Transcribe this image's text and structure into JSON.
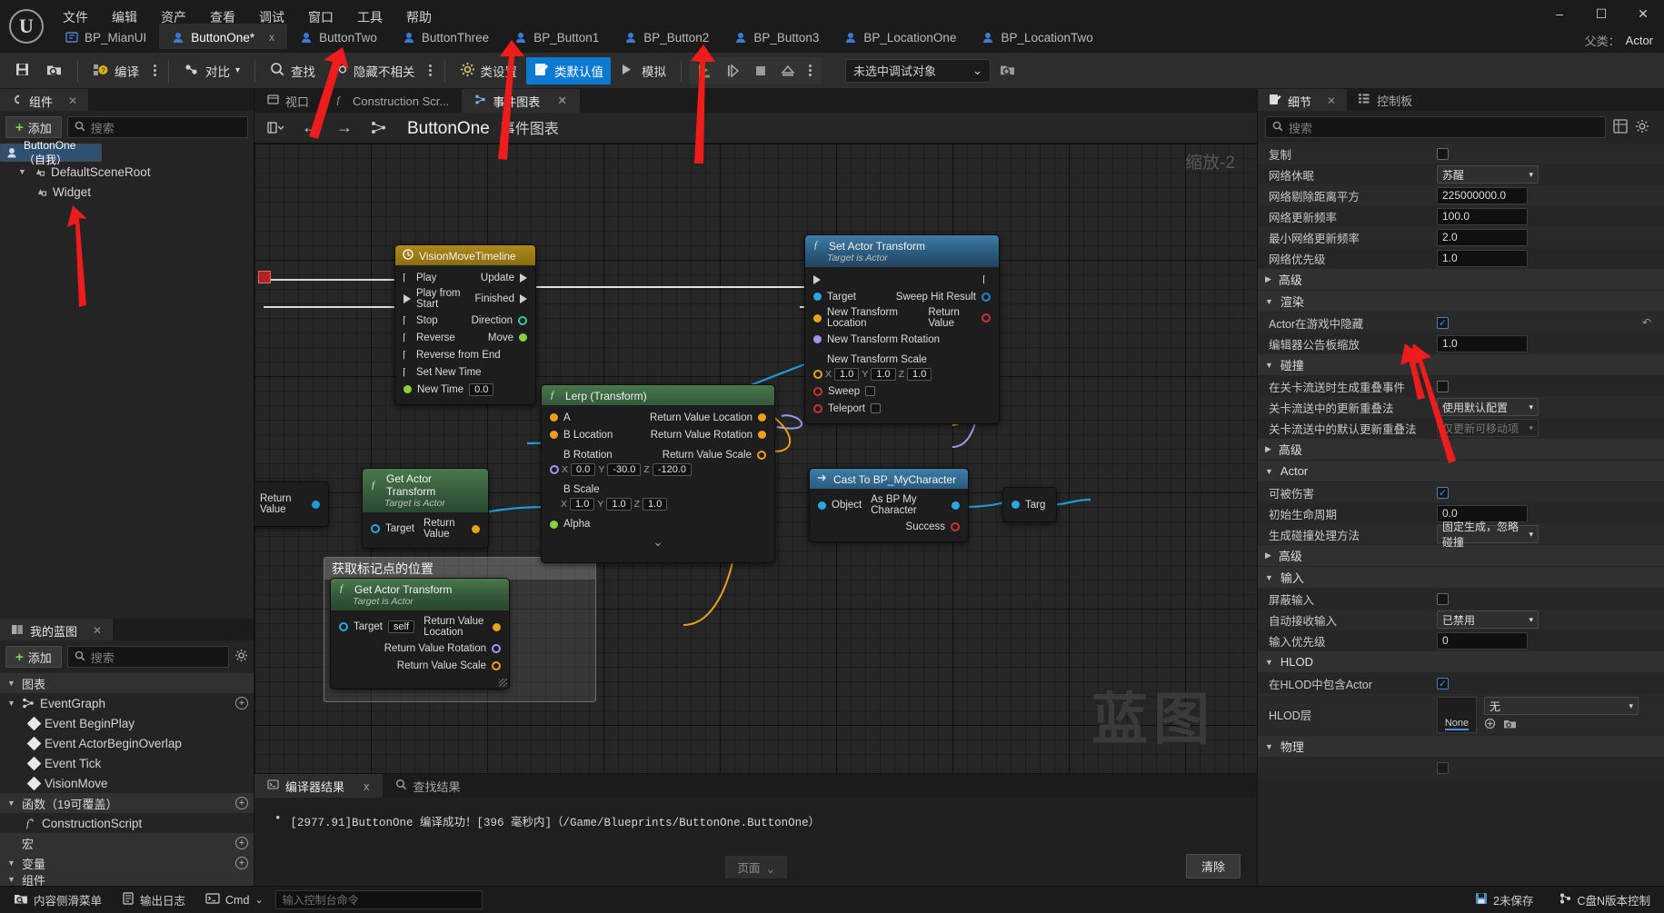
{
  "app": {
    "menus": [
      "文件",
      "编辑",
      "资产",
      "查看",
      "调试",
      "窗口",
      "工具",
      "帮助"
    ],
    "window_buttons": {
      "minimize": "–",
      "maximize": "☐",
      "close": "✕"
    }
  },
  "tabs": {
    "items": [
      {
        "label": "BP_MianUI",
        "icon": "blueprint-ui-icon",
        "active": false,
        "closable": false
      },
      {
        "label": "ButtonOne*",
        "icon": "blueprint-actor-icon",
        "active": true,
        "closable": true,
        "close": "x"
      },
      {
        "label": "ButtonTwo",
        "icon": "blueprint-actor-icon",
        "active": false,
        "closable": false
      },
      {
        "label": "ButtonThree",
        "icon": "blueprint-actor-icon",
        "active": false,
        "closable": false
      },
      {
        "label": "BP_Button1",
        "icon": "blueprint-actor-icon",
        "active": false,
        "closable": false
      },
      {
        "label": "BP_Button2",
        "icon": "blueprint-actor-icon",
        "active": false,
        "closable": false
      },
      {
        "label": "BP_Button3",
        "icon": "blueprint-actor-icon",
        "active": false,
        "closable": false
      },
      {
        "label": "BP_LocationOne",
        "icon": "blueprint-actor-icon",
        "active": false,
        "closable": false
      },
      {
        "label": "BP_LocationTwo",
        "icon": "blueprint-actor-icon",
        "active": false,
        "closable": false
      }
    ],
    "parent_label": "父类：",
    "parent_value": "Actor"
  },
  "toolbar": {
    "save_icon": "save-icon",
    "browse_icon": "browse-content-icon",
    "compile_label": "编译",
    "diff_label": "对比",
    "find_label": "查找",
    "hide_unrelated_label": "隐藏不相关",
    "class_settings_label": "类设置",
    "class_defaults_label": "类默认值",
    "simulate_label": "模拟",
    "debug_object": "未选中调试对象",
    "debug_object_caret": "⌄"
  },
  "components_panel": {
    "tab_title": "组件",
    "close": "✕",
    "add_label": "添加",
    "search_placeholder": "搜索",
    "items": [
      {
        "label": "ButtonOne（自我）",
        "depth": 0,
        "selected": true,
        "icon": "actor-icon",
        "caret": ""
      },
      {
        "label": "DefaultSceneRoot",
        "depth": 1,
        "selected": false,
        "icon": "scene-component-icon",
        "caret": "▼"
      },
      {
        "label": "Widget",
        "depth": 2,
        "selected": false,
        "icon": "scene-component-icon",
        "caret": ""
      }
    ]
  },
  "myblueprint_panel": {
    "tab_title": "我的蓝图",
    "close": "✕",
    "add_label": "添加",
    "search_placeholder": "搜索",
    "sections": [
      {
        "label": "图表",
        "caret": "▼",
        "add": false,
        "items": []
      },
      {
        "label": "EventGraph",
        "caret": "▼",
        "is_graph": true,
        "add": true,
        "items": [
          {
            "label": "Event BeginPlay"
          },
          {
            "label": "Event ActorBeginOverlap"
          },
          {
            "label": "Event Tick"
          },
          {
            "label": "VisionMove"
          }
        ]
      },
      {
        "label": "函数（19可覆盖）",
        "caret": "▼",
        "add": true,
        "items": [
          {
            "label": "ConstructionScript",
            "icon": "function-icon"
          }
        ]
      },
      {
        "label": "宏",
        "caret": "",
        "add": true,
        "items": []
      },
      {
        "label": "变量",
        "caret": "▼",
        "add": true,
        "items": []
      },
      {
        "label": "组件",
        "caret": "▼",
        "add": false,
        "items": []
      }
    ]
  },
  "graph_panel": {
    "tabs": [
      {
        "label": "视口",
        "icon": "viewport-icon",
        "active": false,
        "closable": false
      },
      {
        "label": "Construction Scr...",
        "icon": "function-icon",
        "active": false,
        "closable": false
      },
      {
        "label": "事件图表",
        "icon": "eventgraph-icon",
        "active": true,
        "closable": true,
        "close": "✕"
      }
    ],
    "nav_back": "←",
    "nav_forward": "→",
    "breadcrumb_main": "ButtonOne",
    "breadcrumb_sub": "事件图表",
    "zoom_label": "缩放-2",
    "watermark": "蓝图"
  },
  "nodes": {
    "timeline": {
      "title": "VisionMoveTimeline",
      "icon": "clock-icon",
      "inputs": [
        "Play",
        "Play from Start",
        "Stop",
        "Reverse",
        "Reverse from End",
        "Set New Time"
      ],
      "new_time_label": "New Time",
      "new_time_value": "0.0",
      "outputs": [
        {
          "label": "Update",
          "type": "exec"
        },
        {
          "label": "Finished",
          "type": "exec"
        },
        {
          "label": "Direction",
          "type": "byte"
        },
        {
          "label": "Move",
          "type": "float"
        }
      ]
    },
    "set_actor_transform": {
      "title": "Set Actor Transform",
      "subtitle": "Target is Actor",
      "inputs": [
        {
          "label": "Target",
          "color": "#28a8e0"
        },
        {
          "label": "New Transform Location",
          "color": "#e8a11a"
        },
        {
          "label": "New Transform Rotation",
          "color": "#9a9ae8"
        }
      ],
      "scale_label": "New Transform Scale",
      "scale": {
        "x": "1.0",
        "y": "1.0",
        "z": "1.0"
      },
      "sweep_label": "Sweep",
      "teleport_label": "Teleport",
      "outputs": [
        {
          "label": "Sweep Hit Result",
          "color": "#2f7fd0"
        },
        {
          "label": "Return Value",
          "color": "#c53434"
        }
      ]
    },
    "lerp_transform": {
      "title": "Lerp (Transform)",
      "icon": "function-icon",
      "inputs": [
        {
          "label": "A",
          "color": "#e8a11a"
        },
        {
          "label": "B Location",
          "color": "#e8a11a"
        },
        {
          "label": "B Rotation",
          "color": "#9a9ae8",
          "x": "0.0",
          "y": "-30.0",
          "z": "-120.0"
        },
        {
          "label": "B Scale",
          "color": "#e8a11a",
          "x": "1.0",
          "y": "1.0",
          "z": "1.0"
        },
        {
          "label": "Alpha",
          "color": "#8ccf3f"
        }
      ],
      "outputs": [
        {
          "label": "Return Value Location",
          "color": "#e8a11a"
        },
        {
          "label": "Return Value Rotation",
          "color": "#e8a11a"
        },
        {
          "label": "Return Value Scale",
          "color": "#e8a11a"
        }
      ],
      "collapse": "⌄"
    },
    "get_actor_transform_1": {
      "title": "Get Actor Transform",
      "subtitle": "Target is Actor",
      "target_label": "Target",
      "return_label": "Return Value"
    },
    "cast_node": {
      "title": "Cast To BP_MyCharacter",
      "object_label": "Object",
      "as_label": "As BP My Character",
      "success_label": "Success"
    },
    "right_node": {
      "target_label": "Targ"
    },
    "comment": {
      "title": "获取标记点的位置",
      "node_title": "Get Actor Transform",
      "node_subtitle": "Target is Actor",
      "target_label": "Target",
      "target_value": "self",
      "outputs": [
        "Return Value Location",
        "Return Value Rotation",
        "Return Value Scale"
      ]
    }
  },
  "results_panel": {
    "tabs": [
      {
        "label": "编译器结果",
        "icon": "compiler-icon",
        "active": true,
        "close": "x"
      },
      {
        "label": "查找结果",
        "icon": "search-icon",
        "active": false
      }
    ],
    "message": "[2977.91]ButtonOne 编译成功！[396 毫秒内]（/Game/Blueprints/ButtonOne.ButtonOne）",
    "page_label": "页面 ⌄",
    "clear_label": "清除"
  },
  "details_panel": {
    "tabs": [
      {
        "label": "细节",
        "icon": "details-icon",
        "active": true,
        "close": "✕"
      },
      {
        "label": "控制板",
        "icon": "palette-icon",
        "active": false
      }
    ],
    "search_placeholder": "搜索",
    "groups": [
      {
        "type": "props",
        "rows": [
          {
            "name": "复制",
            "kind": "check",
            "value": false
          },
          {
            "name": "网络休眠",
            "kind": "select",
            "value": "苏醒"
          },
          {
            "name": "网络剔除距离平方",
            "kind": "input",
            "value": "225000000.0"
          },
          {
            "name": "网络更新频率",
            "kind": "input",
            "value": "100.0"
          },
          {
            "name": "最小网络更新频率",
            "kind": "input",
            "value": "2.0"
          },
          {
            "name": "网络优先级",
            "kind": "input",
            "value": "1.0"
          }
        ]
      },
      {
        "type": "cat",
        "label": "高级",
        "open": false
      },
      {
        "type": "cat",
        "label": "渲染",
        "open": true
      },
      {
        "type": "props",
        "rows": [
          {
            "name": "Actor在游戏中隐藏",
            "kind": "check",
            "value": true,
            "revert": true
          },
          {
            "name": "编辑器公告板缩放",
            "kind": "input",
            "value": "1.0"
          }
        ]
      },
      {
        "type": "cat",
        "label": "碰撞",
        "open": true
      },
      {
        "type": "props",
        "rows": [
          {
            "name": "在关卡流送时生成重叠事件",
            "kind": "check",
            "value": false
          },
          {
            "name": "关卡流送中的更新重叠法",
            "kind": "select",
            "value": "使用默认配置"
          },
          {
            "name": "关卡流送中的默认更新重叠法",
            "kind": "select-disabled",
            "value": "仅更新可移动项"
          }
        ]
      },
      {
        "type": "cat",
        "label": "高级",
        "open": false
      },
      {
        "type": "cat",
        "label": "Actor",
        "open": true
      },
      {
        "type": "props",
        "rows": [
          {
            "name": "可被伤害",
            "kind": "check",
            "value": true
          },
          {
            "name": "初始生命周期",
            "kind": "input",
            "value": "0.0"
          },
          {
            "name": "生成碰撞处理方法",
            "kind": "select",
            "value": "固定生成，忽略碰撞"
          }
        ]
      },
      {
        "type": "cat",
        "label": "高级",
        "open": false
      },
      {
        "type": "cat",
        "label": "输入",
        "open": true
      },
      {
        "type": "props",
        "rows": [
          {
            "name": "屏蔽输入",
            "kind": "check",
            "value": false
          },
          {
            "name": "自动接收输入",
            "kind": "select",
            "value": "已禁用"
          },
          {
            "name": "输入优先级",
            "kind": "input",
            "value": "0"
          }
        ]
      },
      {
        "type": "cat",
        "label": "HLOD",
        "open": true
      },
      {
        "type": "props",
        "rows": [
          {
            "name": "在HLOD中包含Actor",
            "kind": "check",
            "value": true
          }
        ]
      },
      {
        "type": "hlod",
        "name": "HLOD层",
        "none_label": "None",
        "value": "无"
      },
      {
        "type": "cat",
        "label": "物理",
        "open": true
      }
    ]
  },
  "status_bar": {
    "content_drawer": "内容侧滑菜单",
    "output_log": "输出日志",
    "cmd": "Cmd",
    "cmd_caret": "⌄",
    "console_placeholder": "输入控制台命令",
    "unsaved": "2未保存",
    "revision": "C盘N版本控制"
  }
}
